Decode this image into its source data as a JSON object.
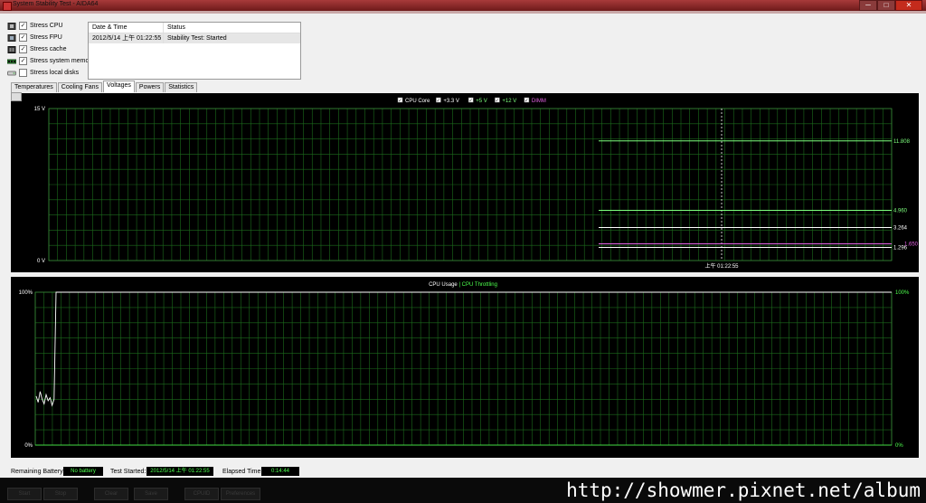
{
  "window": {
    "title": "System Stability Test - AIDA64",
    "min": "─",
    "max": "□",
    "close": "✕"
  },
  "stress_options": [
    {
      "label": "Stress CPU",
      "checked": true
    },
    {
      "label": "Stress FPU",
      "checked": true
    },
    {
      "label": "Stress cache",
      "checked": true
    },
    {
      "label": "Stress system memory",
      "checked": true
    },
    {
      "label": "Stress local disks",
      "checked": false
    }
  ],
  "log": {
    "headers": [
      "Date & Time",
      "Status"
    ],
    "rows": [
      {
        "datetime": "2012/5/14 上午 01:22:55",
        "status": "Stability Test: Started"
      }
    ]
  },
  "tabs": [
    "Temperatures",
    "Cooling Fans",
    "Voltages",
    "Powers",
    "Statistics"
  ],
  "active_tab": 2,
  "chart_data": [
    {
      "type": "line",
      "ylim": [
        0,
        15
      ],
      "ytick_labels": [
        "15 V",
        "0 V"
      ],
      "x_marker_label": "上午 01:22:55",
      "grid": true,
      "legend": "top-center",
      "series": [
        {
          "name": "CPU Core",
          "color": "#ffffff",
          "values": [
            1.296
          ],
          "label": "1.296"
        },
        {
          "name": "+3.3 V",
          "color": "#ffffff",
          "values": [
            3.264
          ],
          "label": "3.264"
        },
        {
          "name": "+5 V",
          "color": "#7dff7d",
          "values": [
            4.96
          ],
          "label": "4.960"
        },
        {
          "name": "+12 V",
          "color": "#7dff7d",
          "values": [
            11.808
          ],
          "label": "11.808"
        },
        {
          "name": "DIMM",
          "color": "#e060e0",
          "values": [
            1.65
          ],
          "label": "1.650"
        }
      ]
    },
    {
      "type": "line",
      "ylim": [
        0,
        100
      ],
      "ytick_labels": [
        "100%",
        "0%"
      ],
      "right_tick_labels": [
        "100%",
        "0%"
      ],
      "grid": true,
      "legend": "top-center",
      "legend_separator": "|",
      "series": [
        {
          "name": "CPU Usage",
          "color": "#ffffff",
          "values": [
            32,
            28,
            35,
            30,
            27,
            33,
            29,
            31,
            26,
            30,
            100,
            100,
            100,
            100,
            100,
            100,
            100,
            100,
            100,
            100
          ]
        },
        {
          "name": "CPU Throttling",
          "color": "#4cff4c",
          "values": [
            0,
            0,
            0,
            0,
            0,
            0,
            0,
            0,
            0,
            0,
            0,
            0,
            0,
            0,
            0,
            0,
            0,
            0,
            0,
            0
          ]
        }
      ]
    }
  ],
  "status": {
    "battery_label": "Remaining Battery:",
    "battery_value": "No battery",
    "started_label": "Test Started:",
    "started_value": "2012/5/14 上午 01:22:55",
    "elapsed_label": "Elapsed Time:",
    "elapsed_value": "0:14:44"
  },
  "buttons": [
    "Start",
    "Stop",
    "Clear",
    "Save",
    "CPUID",
    "Preferences"
  ],
  "watermark": "http://showmer.pixnet.net/album"
}
